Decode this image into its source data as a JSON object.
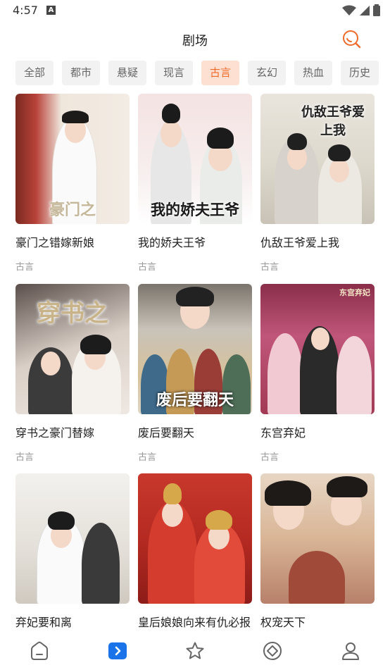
{
  "status": {
    "time": "4:57",
    "notification_letter": "A"
  },
  "header": {
    "title": "剧场"
  },
  "tabs": [
    {
      "label": "全部",
      "active": false
    },
    {
      "label": "都市",
      "active": false
    },
    {
      "label": "悬疑",
      "active": false
    },
    {
      "label": "现言",
      "active": false
    },
    {
      "label": "古言",
      "active": true
    },
    {
      "label": "玄幻",
      "active": false
    },
    {
      "label": "热血",
      "active": false
    },
    {
      "label": "历史",
      "active": false
    }
  ],
  "cards": [
    {
      "title": "豪门之错嫁新娘",
      "genre": "古言",
      "cover_text": "豪门之"
    },
    {
      "title": "我的娇夫王爷",
      "genre": "古言",
      "cover_text": "我的娇夫王爷"
    },
    {
      "title": "仇敌王爷爱上我",
      "genre": "古言",
      "cover_text": "仇敌王爷爱上我"
    },
    {
      "title": "穿书之豪门替嫁",
      "genre": "古言",
      "cover_text": "穿书之"
    },
    {
      "title": "废后要翻天",
      "genre": "古言",
      "cover_text": "废后要翻天"
    },
    {
      "title": "东宫弃妃",
      "genre": "古言",
      "cover_text": "东宫弃妃"
    },
    {
      "title": "弃妃要和离",
      "genre": "",
      "cover_text": ""
    },
    {
      "title": "皇后娘娘向来有仇必报",
      "genre": "",
      "cover_text": ""
    },
    {
      "title": "权宠天下",
      "genre": "",
      "cover_text": ""
    }
  ],
  "colors": {
    "accent": "#ef6b2a",
    "nav_active": "#1a73e8"
  },
  "bottom_nav": [
    {
      "icon": "home-icon",
      "active": false
    },
    {
      "icon": "play-icon",
      "active": true
    },
    {
      "icon": "star-icon",
      "active": false
    },
    {
      "icon": "discover-icon",
      "active": false
    },
    {
      "icon": "profile-icon",
      "active": false
    }
  ]
}
